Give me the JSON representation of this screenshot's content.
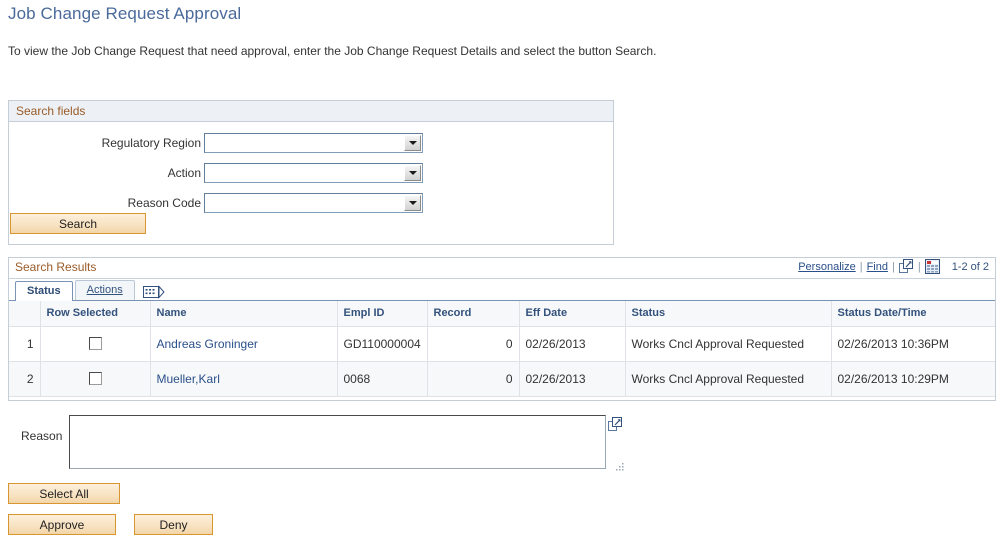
{
  "page": {
    "title": "Job Change Request Approval",
    "intro": "To view the Job Change Request that need approval, enter the Job Change Request Details and select the button Search."
  },
  "search_fields": {
    "header": "Search fields",
    "fields": [
      {
        "label": "Regulatory Region",
        "value": "",
        "icon": "chevron-down-icon"
      },
      {
        "label": "Action",
        "value": "",
        "icon": "chevron-down-icon"
      },
      {
        "label": "Reason Code",
        "value": "",
        "icon": "chevron-down-icon"
      }
    ],
    "search_button": "Search"
  },
  "search_results": {
    "header": "Search Results",
    "tools": {
      "personalize": "Personalize",
      "find": "Find",
      "separator": "|",
      "view_all_icon": "expand-view-all-icon",
      "download_icon": "download-to-spreadsheet-icon",
      "counter": "1-2 of 2"
    },
    "tabs": [
      {
        "label": "Status",
        "active": true,
        "accesskey": ""
      },
      {
        "label": "Actions",
        "active": false,
        "accesskey": "A"
      }
    ],
    "tab_expand_icon": "show-all-columns-icon",
    "columns": [
      "",
      "Row Selected",
      "Name",
      "Empl ID",
      "Record",
      "Eff Date",
      "Status",
      "Status Date/Time"
    ],
    "rows": [
      {
        "num": "1",
        "selected": false,
        "name": "Andreas Groninger",
        "empl_id": "GD110000004",
        "record": "0",
        "eff_date": "02/26/2013",
        "status": "Works Cncl Approval Requested",
        "status_datetime": "02/26/2013 10:36PM"
      },
      {
        "num": "2",
        "selected": false,
        "name": "Mueller,Karl",
        "empl_id": "0068",
        "record": "0",
        "eff_date": "02/26/2013",
        "status": "Works Cncl Approval Requested",
        "status_datetime": "02/26/2013 10:29PM"
      }
    ]
  },
  "reason": {
    "label": "Reason",
    "value": "",
    "placeholder": "",
    "expand_icon": "expand-field-icon"
  },
  "actions": {
    "select_all": "Select All",
    "approve": "Approve",
    "deny": "Deny"
  },
  "colors": {
    "title_blue": "#4a6a9a",
    "section_header_brown": "#9a5b28",
    "link_blue": "#2a4f8a",
    "column_header_blue": "#33527d",
    "row_number_orange": "#b4701d",
    "button_border_orange": "#d9952f",
    "panel_border": "#c5cdd6"
  }
}
